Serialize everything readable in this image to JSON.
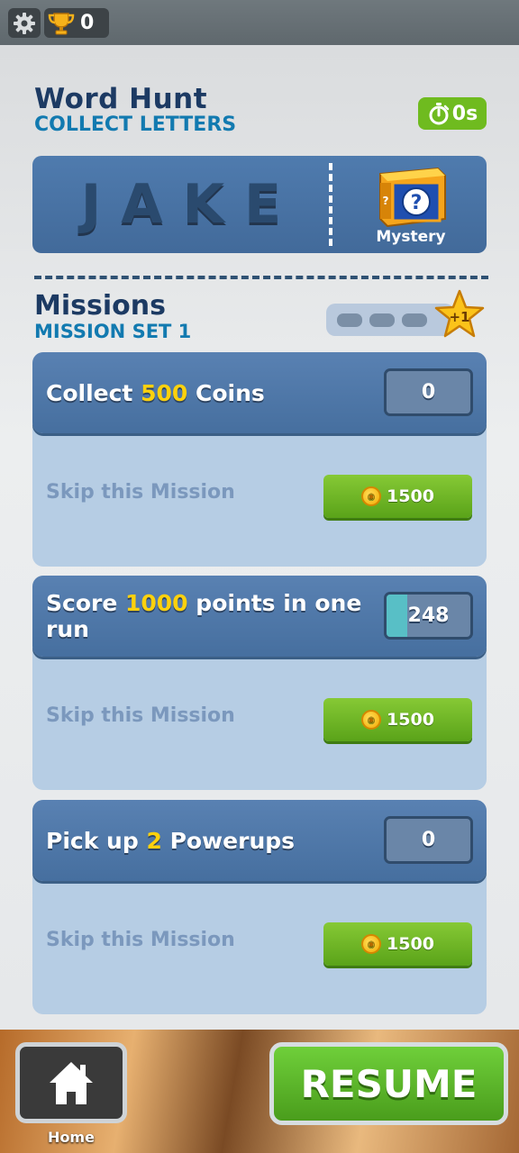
{
  "topbar": {
    "trophy_count": "0",
    "icons": {
      "settings": "gear-icon",
      "trophy": "trophy-icon"
    }
  },
  "event": {
    "title": "Word Hunt",
    "subtitle": "COLLECT LETTERS",
    "timer": "0s",
    "word": "JAKE",
    "reward_label": "Mystery"
  },
  "missions": {
    "title": "Missions",
    "subtitle": "MISSION SET 1",
    "completed": 0,
    "total": 3,
    "star_badge": "+1",
    "items": [
      {
        "pre": "Collect ",
        "highlight": "500",
        "post": " Coins",
        "count": "0",
        "progress": 0.0,
        "skip_label": "Skip this Mission",
        "skip_cost": "1500"
      },
      {
        "pre": "Score ",
        "highlight": "1000",
        "post": " points in one run",
        "count": "248",
        "progress": 0.248,
        "skip_label": "Skip this Mission",
        "skip_cost": "1500"
      },
      {
        "pre": "Pick up ",
        "highlight": "2",
        "post": " Powerups",
        "count": "0",
        "progress": 0.0,
        "skip_label": "Skip this Mission",
        "skip_cost": "1500"
      }
    ]
  },
  "bottom": {
    "home_label": "Home",
    "resume_label": "RESUME"
  },
  "colors": {
    "accent_green": "#5aa319",
    "title_navy": "#1c3a63",
    "subtitle_blue": "#127ab0",
    "highlight_yellow": "#fdd10d"
  }
}
